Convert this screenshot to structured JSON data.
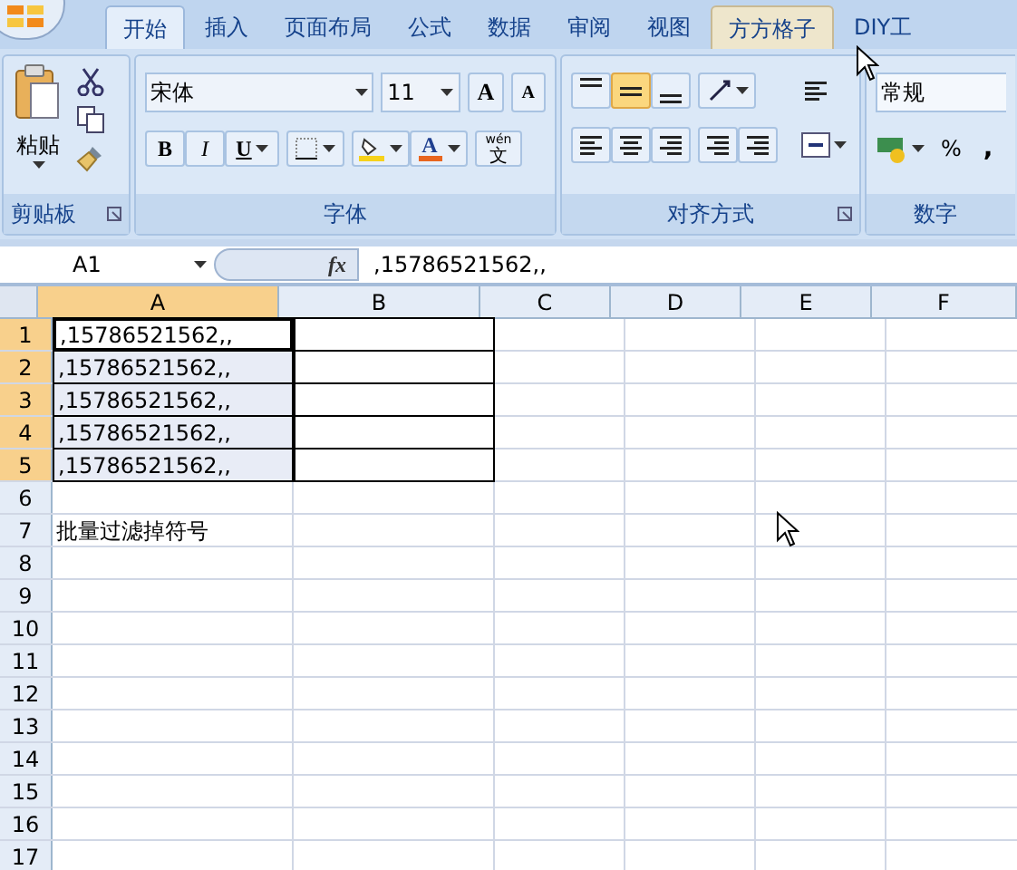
{
  "tabs": [
    {
      "label": "开始",
      "selected": true,
      "hovered": false
    },
    {
      "label": "插入",
      "selected": false,
      "hovered": false
    },
    {
      "label": "页面布局",
      "selected": false,
      "hovered": false
    },
    {
      "label": "公式",
      "selected": false,
      "hovered": false
    },
    {
      "label": "数据",
      "selected": false,
      "hovered": false
    },
    {
      "label": "审阅",
      "selected": false,
      "hovered": false
    },
    {
      "label": "视图",
      "selected": false,
      "hovered": false
    },
    {
      "label": "方方格子",
      "selected": false,
      "hovered": true
    },
    {
      "label": "DIY工",
      "selected": false,
      "hovered": false
    }
  ],
  "ribbon": {
    "clipboard": {
      "paste": "粘贴",
      "title": "剪贴板"
    },
    "font": {
      "name": "宋体",
      "size": "11",
      "grow": "A",
      "shrink": "A",
      "bold": "B",
      "italic": "I",
      "underline": "U",
      "font_color": "A",
      "phonetic_top": "wén",
      "phonetic_bottom": "文",
      "title": "字体"
    },
    "alignment": {
      "title": "对齐方式",
      "vertical": [
        {
          "kind": "top",
          "selected": false
        },
        {
          "kind": "middle",
          "selected": true
        },
        {
          "kind": "bottom",
          "selected": false
        }
      ]
    },
    "number": {
      "format": "常规",
      "percent": "%",
      "comma": ",",
      "title": "数字"
    }
  },
  "formula_bar": {
    "name_box": "A1",
    "fx": "fx",
    "content": ",15786521562,,"
  },
  "columns": [
    {
      "label": "A",
      "selected": true
    },
    {
      "label": "B",
      "selected": false
    },
    {
      "label": "C",
      "selected": false
    },
    {
      "label": "D",
      "selected": false
    },
    {
      "label": "E",
      "selected": false
    },
    {
      "label": "F",
      "selected": false
    }
  ],
  "rows": [
    {
      "label": "1",
      "selected": true,
      "active": true,
      "bordered": true,
      "cells": [
        ",15786521562,,"
      ]
    },
    {
      "label": "2",
      "selected": true,
      "active": false,
      "bordered": true,
      "cells": [
        ",15786521562,,"
      ]
    },
    {
      "label": "3",
      "selected": true,
      "active": false,
      "bordered": true,
      "cells": [
        ",15786521562,,"
      ]
    },
    {
      "label": "4",
      "selected": true,
      "active": false,
      "bordered": true,
      "cells": [
        ",15786521562,,"
      ]
    },
    {
      "label": "5",
      "selected": true,
      "active": false,
      "bordered": true,
      "cells": [
        ",15786521562,,"
      ]
    },
    {
      "label": "6",
      "selected": false,
      "active": false,
      "bordered": false,
      "cells": []
    },
    {
      "label": "7",
      "selected": false,
      "active": false,
      "bordered": false,
      "cells": [
        "批量过滤掉符号"
      ]
    },
    {
      "label": "8",
      "selected": false,
      "active": false,
      "bordered": false,
      "cells": []
    },
    {
      "label": "9",
      "selected": false,
      "active": false,
      "bordered": false,
      "cells": []
    },
    {
      "label": "10",
      "selected": false,
      "active": false,
      "bordered": false,
      "cells": []
    },
    {
      "label": "11",
      "selected": false,
      "active": false,
      "bordered": false,
      "cells": []
    },
    {
      "label": "12",
      "selected": false,
      "active": false,
      "bordered": false,
      "cells": []
    },
    {
      "label": "13",
      "selected": false,
      "active": false,
      "bordered": false,
      "cells": []
    },
    {
      "label": "14",
      "selected": false,
      "active": false,
      "bordered": false,
      "cells": []
    },
    {
      "label": "15",
      "selected": false,
      "active": false,
      "bordered": false,
      "cells": []
    },
    {
      "label": "16",
      "selected": false,
      "active": false,
      "bordered": false,
      "cells": []
    },
    {
      "label": "17",
      "selected": false,
      "active": false,
      "bordered": false,
      "cells": []
    }
  ]
}
